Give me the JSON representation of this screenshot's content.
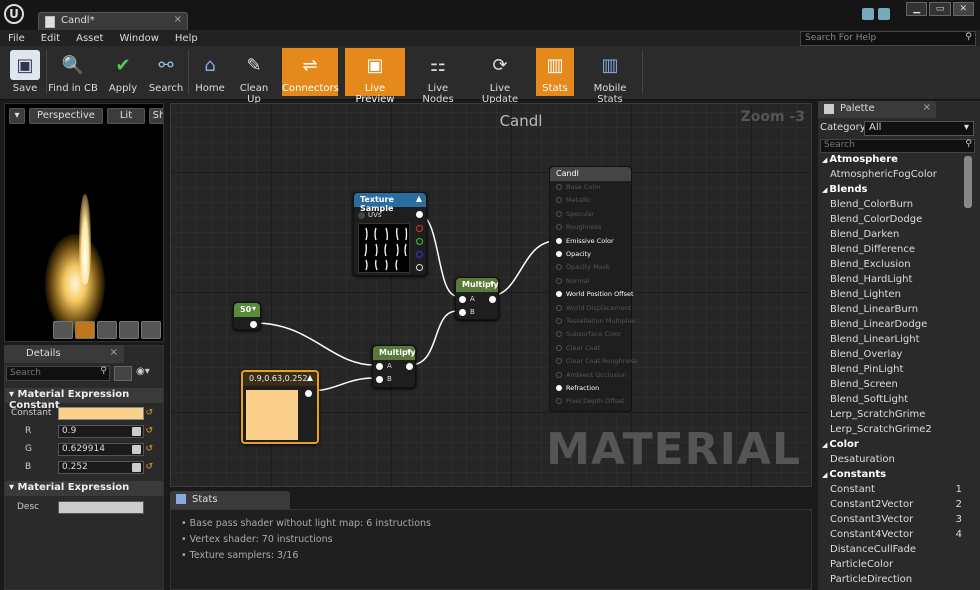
{
  "window": {
    "tab_title": "Candl*",
    "close_glyph": "×",
    "controls": [
      "▁",
      "▭",
      "✕"
    ]
  },
  "menu": [
    "File",
    "Edit",
    "Asset",
    "Window",
    "Help"
  ],
  "search_help_placeholder": "Search For Help",
  "toolbar": [
    {
      "label": "Save",
      "icon": "save-icon",
      "active": false
    },
    {
      "label": "Find in CB",
      "icon": "find-icon",
      "active": false
    },
    {
      "label": "Apply",
      "icon": "apply-icon",
      "active": false
    },
    {
      "label": "Search",
      "icon": "search-icon",
      "active": false
    },
    {
      "label": "Home",
      "icon": "home-icon",
      "active": false
    },
    {
      "label": "Clean Up",
      "icon": "cleanup-icon",
      "active": false
    },
    {
      "label": "Connectors",
      "icon": "connectors-icon",
      "active": true
    },
    {
      "label": "Live Preview",
      "icon": "live-preview-icon",
      "active": true
    },
    {
      "label": "Live Nodes",
      "icon": "live-nodes-icon",
      "active": false
    },
    {
      "label": "Live Update",
      "icon": "live-update-icon",
      "active": false
    },
    {
      "label": "Stats",
      "icon": "stats-icon",
      "active": true
    },
    {
      "label": "Mobile Stats",
      "icon": "mobile-stats-icon",
      "active": false
    }
  ],
  "viewport": {
    "perspective_label": "Perspective",
    "lit_label": "Lit",
    "show_label": "Sh"
  },
  "details": {
    "tab_label": "Details",
    "search_placeholder": "Search",
    "section1": "Material Expression Constant",
    "constant_label": "Constant",
    "r_label": "R",
    "r_value": "0.9",
    "g_label": "G",
    "g_value": "0.629914",
    "b_label": "B",
    "b_value": "0.252",
    "section2": "Material Expression",
    "desc_label": "Desc",
    "constant_color": "#fbd08a"
  },
  "graph": {
    "title": "Candl",
    "zoom": "Zoom -3",
    "watermark": "MATERIAL",
    "texture_node": {
      "title": "Texture Sample",
      "uv_label": "UVs"
    },
    "multiply1": {
      "title": "Multiply",
      "a": "A",
      "b": "B"
    },
    "multiply2": {
      "title": "Multiply",
      "a": "A",
      "b": "B"
    },
    "scalar_node": {
      "title": "50"
    },
    "color_node": {
      "title": "0.9,0.63,0.252"
    },
    "material_node": {
      "title": "Candl",
      "pins": [
        {
          "label": "Base Color",
          "on": false
        },
        {
          "label": "Metallic",
          "on": false
        },
        {
          "label": "Specular",
          "on": false
        },
        {
          "label": "Roughness",
          "on": false
        },
        {
          "label": "Emissive Color",
          "on": true
        },
        {
          "label": "Opacity",
          "on": true
        },
        {
          "label": "Opacity Mask",
          "on": false
        },
        {
          "label": "Normal",
          "on": false
        },
        {
          "label": "World Position Offset",
          "on": true
        },
        {
          "label": "World Displacement",
          "on": false
        },
        {
          "label": "Tessellation Multiplier",
          "on": false
        },
        {
          "label": "Subsurface Color",
          "on": false
        },
        {
          "label": "Clear Coat",
          "on": false
        },
        {
          "label": "Clear Coat Roughness",
          "on": false
        },
        {
          "label": "Ambient Occlusion",
          "on": false
        },
        {
          "label": "Refraction",
          "on": true
        },
        {
          "label": "Pixel Depth Offset",
          "on": false
        }
      ]
    }
  },
  "stats": {
    "tab_label": "Stats",
    "lines": [
      "Base pass shader without light map: 6 instructions",
      "Vertex shader: 70 instructions",
      "Texture samplers: 3/16"
    ]
  },
  "palette": {
    "tab_label": "Palette",
    "category_label": "Category:",
    "category_value": "All",
    "search_placeholder": "Search",
    "items": [
      {
        "label": "Atmosphere",
        "type": "cat"
      },
      {
        "label": "AtmosphericFogColor",
        "type": "leaf"
      },
      {
        "label": "Blends",
        "type": "cat"
      },
      {
        "label": "Blend_ColorBurn",
        "type": "leaf"
      },
      {
        "label": "Blend_ColorDodge",
        "type": "leaf"
      },
      {
        "label": "Blend_Darken",
        "type": "leaf"
      },
      {
        "label": "Blend_Difference",
        "type": "leaf"
      },
      {
        "label": "Blend_Exclusion",
        "type": "leaf"
      },
      {
        "label": "Blend_HardLight",
        "type": "leaf"
      },
      {
        "label": "Blend_Lighten",
        "type": "leaf"
      },
      {
        "label": "Blend_LinearBurn",
        "type": "leaf"
      },
      {
        "label": "Blend_LinearDodge",
        "type": "leaf"
      },
      {
        "label": "Blend_LinearLight",
        "type": "leaf"
      },
      {
        "label": "Blend_Overlay",
        "type": "leaf"
      },
      {
        "label": "Blend_PinLight",
        "type": "leaf"
      },
      {
        "label": "Blend_Screen",
        "type": "leaf"
      },
      {
        "label": "Blend_SoftLight",
        "type": "leaf"
      },
      {
        "label": "Lerp_ScratchGrime",
        "type": "leaf"
      },
      {
        "label": "Lerp_ScratchGrime2",
        "type": "leaf"
      },
      {
        "label": "Color",
        "type": "cat"
      },
      {
        "label": "Desaturation",
        "type": "leaf"
      },
      {
        "label": "Constants",
        "type": "cat"
      },
      {
        "label": "Constant",
        "type": "leaf",
        "hotkey": "1"
      },
      {
        "label": "Constant2Vector",
        "type": "leaf",
        "hotkey": "2"
      },
      {
        "label": "Constant3Vector",
        "type": "leaf",
        "hotkey": "3"
      },
      {
        "label": "Constant4Vector",
        "type": "leaf",
        "hotkey": "4"
      },
      {
        "label": "DistanceCullFade",
        "type": "leaf"
      },
      {
        "label": "ParticleColor",
        "type": "leaf"
      },
      {
        "label": "ParticleDirection",
        "type": "leaf"
      }
    ]
  },
  "colors": {
    "accent": "#e5891c",
    "texture_header": "#2a6ea0",
    "multiply_header": "#5a7a3a",
    "scalar_header": "#5a8a3a",
    "color_header": "#e8a020"
  }
}
